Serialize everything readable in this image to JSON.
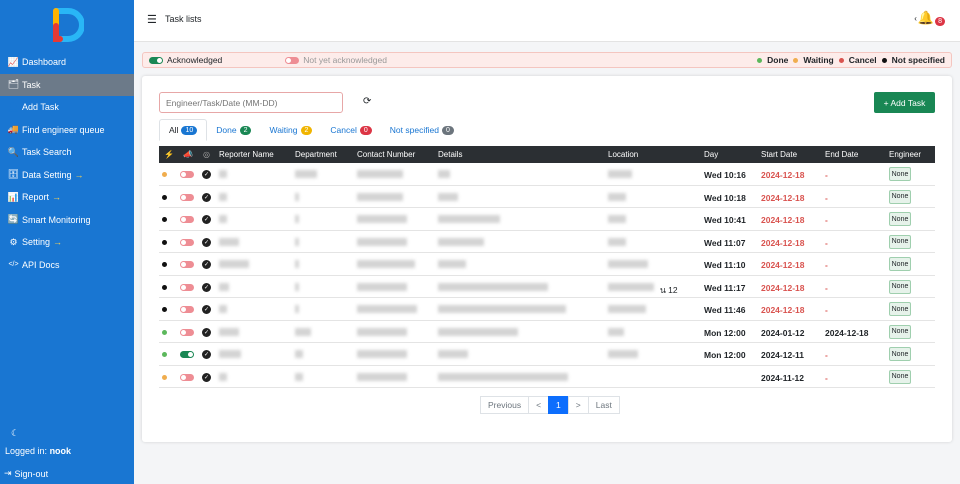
{
  "sidebar": {
    "items": [
      {
        "label": "Dashboard",
        "icon": "chart-line-icon"
      },
      {
        "label": "Task",
        "icon": "tasks-icon",
        "active": true
      },
      {
        "label": "Add Task",
        "icon": "user-plus-icon"
      },
      {
        "label": "Find engineer queue",
        "icon": "truck-icon"
      },
      {
        "label": "Task Search",
        "icon": "search-icon"
      },
      {
        "label": "Data Setting",
        "icon": "database-icon",
        "arrow": "→"
      },
      {
        "label": "Report",
        "icon": "bar-chart-icon",
        "arrow": "→"
      },
      {
        "label": "Smart Monitoring",
        "icon": "sync-icon"
      },
      {
        "label": "Setting",
        "icon": "gear-icon",
        "arrow": "→"
      },
      {
        "label": "API Docs",
        "icon": "code-icon"
      }
    ],
    "logged_in_label": "Logged in:",
    "username": "nook",
    "signout_label": "Sign-out"
  },
  "topbar": {
    "title": "Task lists",
    "notif_count": "8"
  },
  "legend": {
    "acknowledged": "Acknowledged",
    "not_ack": "Not yet acknowledged",
    "done": "Done",
    "waiting": "Waiting",
    "cancel": "Cancel",
    "not_specified": "Not specified"
  },
  "toolbar": {
    "search_placeholder": "Engineer/Task/Date (MM-DD)",
    "add_task": "+ Add Task"
  },
  "tabs": [
    {
      "label": "All",
      "count": "10",
      "color": "#1976d2"
    },
    {
      "label": "Done",
      "count": "2",
      "color": "#198754"
    },
    {
      "label": "Waiting",
      "count": "2",
      "color": "#f0b400"
    },
    {
      "label": "Cancel",
      "count": "0",
      "color": "#dc3545"
    },
    {
      "label": "Not specified",
      "count": "0",
      "color": "#6c757d"
    }
  ],
  "table": {
    "headers": [
      "Reporter Name",
      "Department",
      "Contact Number",
      "Details",
      "Location",
      "Day",
      "Start Date",
      "End Date",
      "Engineer"
    ],
    "rows": [
      {
        "status": "#f0ad4e",
        "ack": false,
        "day": "Wed 10:16",
        "start": "2024-12-18",
        "start_red": true,
        "end": "-",
        "engineer": "None"
      },
      {
        "status": "#111111",
        "ack": false,
        "day": "Wed 10:18",
        "start": "2024-12-18",
        "start_red": true,
        "end": "-",
        "engineer": "None"
      },
      {
        "status": "#111111",
        "ack": false,
        "day": "Wed 10:41",
        "start": "2024-12-18",
        "start_red": true,
        "end": "-",
        "engineer": "None"
      },
      {
        "status": "#111111",
        "ack": false,
        "day": "Wed 11:07",
        "start": "2024-12-18",
        "start_red": true,
        "end": "-",
        "engineer": "None"
      },
      {
        "status": "#111111",
        "ack": false,
        "day": "Wed 11:10",
        "start": "2024-12-18",
        "start_red": true,
        "end": "-",
        "engineer": "None"
      },
      {
        "status": "#111111",
        "ack": false,
        "day": "Wed 11:17",
        "start": "2024-12-18",
        "start_red": true,
        "end": "-",
        "engineer": "None",
        "loc_extra": "น 12"
      },
      {
        "status": "#111111",
        "ack": false,
        "day": "Wed 11:46",
        "start": "2024-12-18",
        "start_red": true,
        "end": "-",
        "engineer": "None"
      },
      {
        "status": "#5cb85c",
        "ack": false,
        "day": "Mon 12:00",
        "start": "2024-01-12",
        "start_red": false,
        "end": "2024-12-18",
        "engineer": "None"
      },
      {
        "status": "#5cb85c",
        "ack": true,
        "day": "Mon 12:00",
        "start": "2024-12-11",
        "start_red": false,
        "end": "-",
        "engineer": "None"
      },
      {
        "status": "#f0ad4e",
        "ack": false,
        "day": "",
        "start": "2024-11-12",
        "start_red": false,
        "end": "-",
        "engineer": "None"
      }
    ]
  },
  "pagination": {
    "previous": "Previous",
    "prev_arrow": "<",
    "current": "1",
    "next_arrow": ">",
    "last": "Last"
  }
}
